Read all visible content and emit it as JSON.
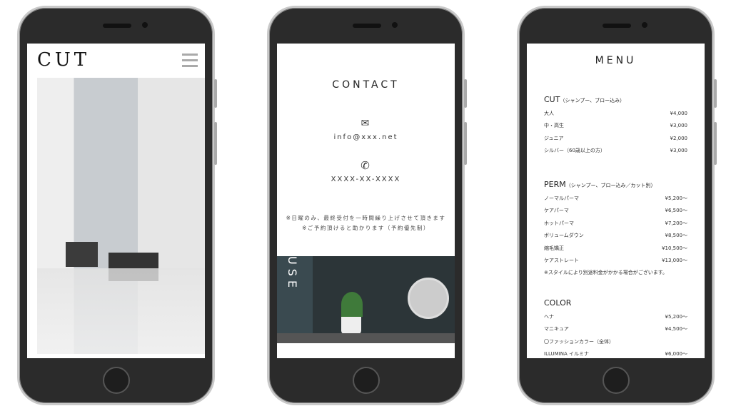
{
  "cut_page": {
    "logo": "CUT"
  },
  "contact_page": {
    "title": "CONTACT",
    "email": "info@xxx.net",
    "phone": "XXXX-XX-XXXX",
    "notes": [
      "※日曜のみ、最終受付を一時間繰り上げさせて頂きます",
      "※ご予約頂けると助かります（予約優先制）"
    ],
    "photo_text": "USE"
  },
  "menu_page": {
    "title": "MENU",
    "sections": [
      {
        "name": "CUT",
        "sub": "（シャンプー、ブロー込み）",
        "items": [
          {
            "label": "大人",
            "price": "¥4,000"
          },
          {
            "label": "中・高生",
            "price": "¥3,000"
          },
          {
            "label": "ジュニア",
            "price": "¥2,000"
          },
          {
            "label": "シルバー（60歳以上の方）",
            "price": "¥3,000"
          }
        ]
      },
      {
        "name": "PERM",
        "sub": "（シャンプー、ブロー込み／カット別）",
        "items": [
          {
            "label": "ノーマルパーマ",
            "price": "¥5,200〜"
          },
          {
            "label": "ケアパーマ",
            "price": "¥6,500〜"
          },
          {
            "label": "ホットパーマ",
            "price": "¥7,200〜"
          },
          {
            "label": "ボリュームダウン",
            "price": "¥8,500〜"
          },
          {
            "label": "縮毛矯正",
            "price": "¥10,500〜"
          },
          {
            "label": "ケアストレート",
            "price": "¥13,000〜"
          }
        ],
        "note": "※スタイルにより別途料金がかかる場合がございます。"
      },
      {
        "name": "COLOR",
        "sub": "",
        "items": [
          {
            "label": "ヘナ",
            "price": "¥5,200〜"
          },
          {
            "label": "マニキュア",
            "price": "¥4,500〜"
          },
          {
            "label": "〇ファッションカラー（全体）",
            "price": ""
          },
          {
            "label": "ILLUMINA イルミナ",
            "price": "¥6,000〜"
          }
        ]
      }
    ]
  }
}
